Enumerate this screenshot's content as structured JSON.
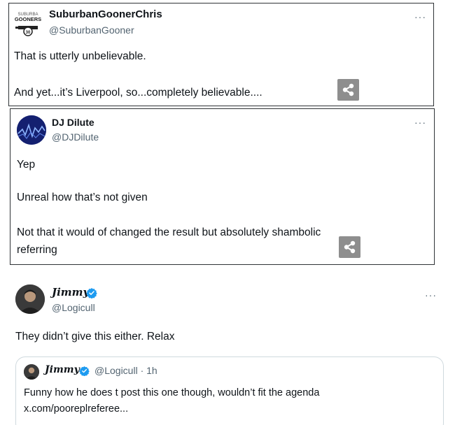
{
  "tweets": [
    {
      "display_name": "SuburbanGoonerChris",
      "handle": "@SuburbanGooner",
      "avatar_text": [
        "SUBURBA",
        "GOONERS"
      ],
      "lines": [
        "That is utterly unbelievable.",
        "And yet...it’s Liverpool, so...completely believable...."
      ],
      "more_icon": "···"
    },
    {
      "display_name": "DJ Dilute",
      "handle": "@DJDilute",
      "lines": [
        "Yep",
        "Unreal how that’s not given",
        "Not that it would of changed the result but absolutely shambolic",
        "referring"
      ],
      "more_icon": "···"
    },
    {
      "display_name": "Jimmy",
      "handle": "@Logicull",
      "lines": [
        "They didn’t give this either. Relax"
      ],
      "more_icon": "···",
      "quote": {
        "display_name": "Jimmy",
        "handle_time": "@Logicull · 1h",
        "lines": [
          "Funny how he does t post this one though, wouldn’t fit the agenda",
          "x.com/pooreplreferee..."
        ]
      }
    }
  ],
  "colors": {
    "verified": "#1d9bf0",
    "secondary_text": "#536471",
    "share_button": "#8e8e8e"
  }
}
